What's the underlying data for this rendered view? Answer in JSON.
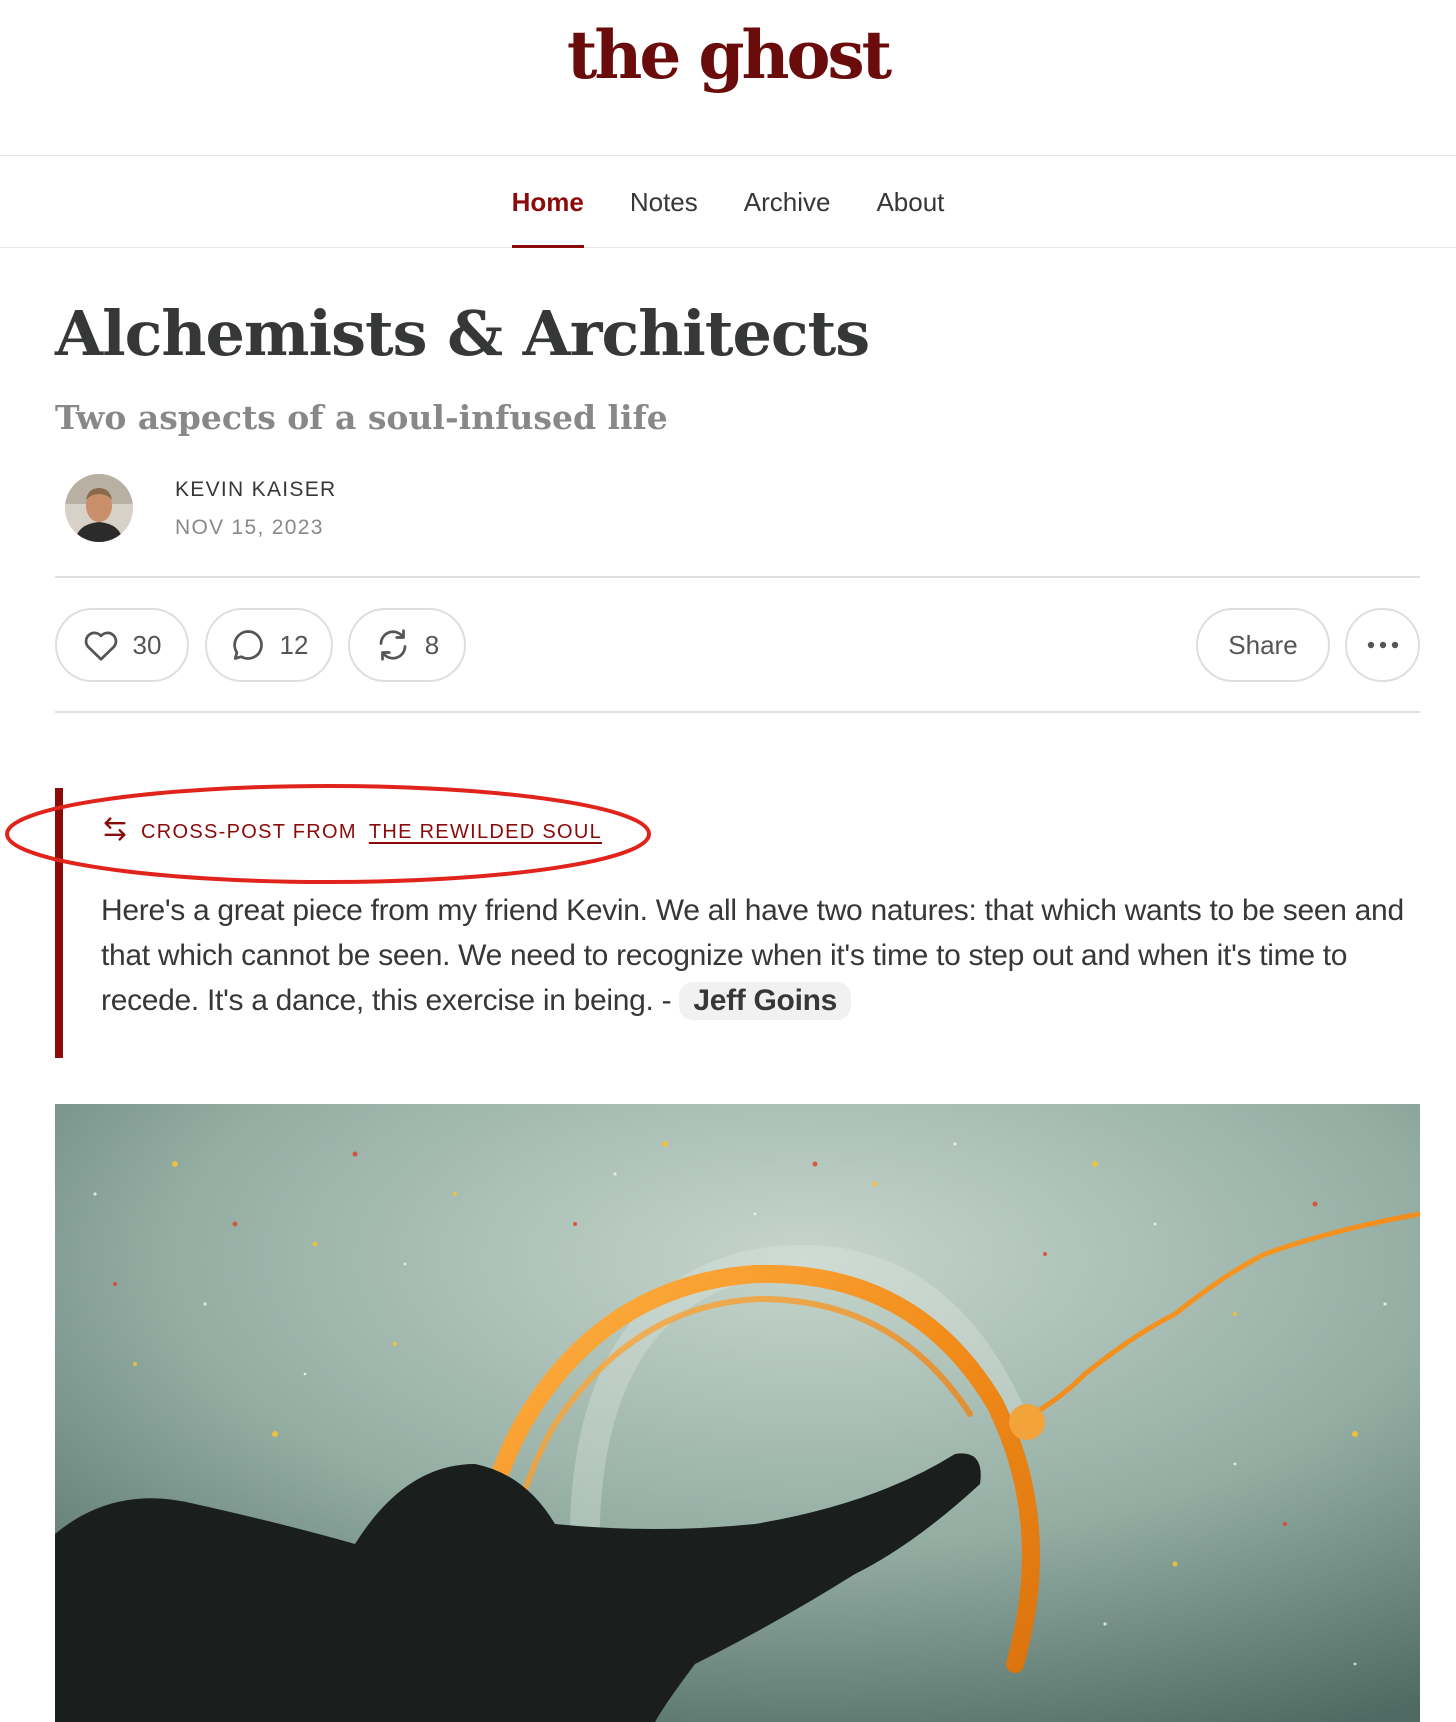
{
  "site": {
    "brand": "the ghost"
  },
  "nav": {
    "items": [
      "Home",
      "Notes",
      "Archive",
      "About"
    ],
    "active": "Home"
  },
  "post": {
    "title": "Alchemists & Architects",
    "subtitle": "Two aspects of a soul-infused life",
    "author": "KEVIN KAISER",
    "date": "NOV 15, 2023"
  },
  "actions": {
    "likes": "30",
    "comments": "12",
    "restacks": "8",
    "share_label": "Share"
  },
  "crosspost": {
    "prefix": "CROSS-POST FROM",
    "source": "THE REWILDED SOUL",
    "text": "Here's a great piece from my friend Kevin. We all have two natures: that which wants to be seen and that which cannot be seen. We need to recognize when it's time to step out and when it's time to recede. It's a dance, this exercise in being. -",
    "mention": "Jeff Goins"
  },
  "colors": {
    "accent": "#8b0a0a",
    "brand": "#6b0c0c",
    "annotation": "#e0241b"
  },
  "icons": [
    "heart-icon",
    "comment-icon",
    "restack-icon",
    "more-icon",
    "crosspost-arrows-icon"
  ]
}
